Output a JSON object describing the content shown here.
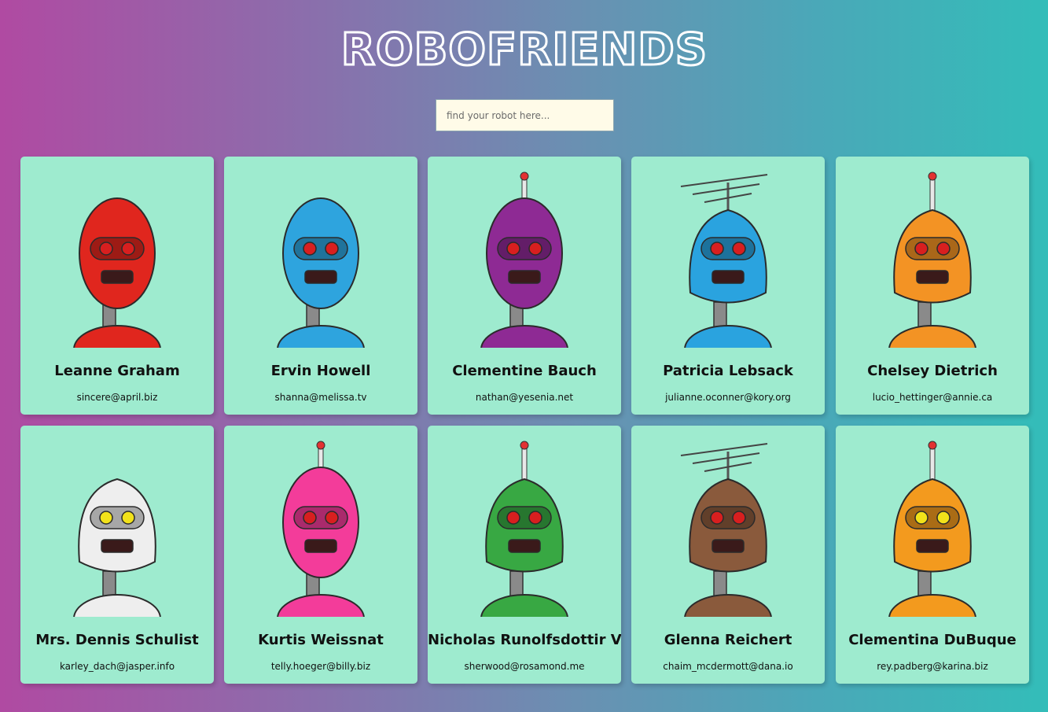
{
  "app": {
    "title": "ROBOFRIENDS"
  },
  "search": {
    "placeholder": "find your robot here..."
  },
  "robots": [
    {
      "name": "Leanne Graham",
      "email": "sincere@april.biz",
      "color": "#e0261e"
    },
    {
      "name": "Ervin Howell",
      "email": "shanna@melissa.tv",
      "color": "#2ea4de"
    },
    {
      "name": "Clementine Bauch",
      "email": "nathan@yesenia.net",
      "color": "#8e2a94"
    },
    {
      "name": "Patricia Lebsack",
      "email": "julianne.oconner@kory.org",
      "color": "#2aa3df"
    },
    {
      "name": "Chelsey Dietrich",
      "email": "lucio_hettinger@annie.ca",
      "color": "#f39324"
    },
    {
      "name": "Mrs. Dennis Schulist",
      "email": "karley_dach@jasper.info",
      "color": "#eeeeee"
    },
    {
      "name": "Kurtis Weissnat",
      "email": "telly.hoeger@billy.biz",
      "color": "#f33c9a"
    },
    {
      "name": "Nicholas Runolfsdottir V",
      "email": "sherwood@rosamond.me",
      "color": "#38a843"
    },
    {
      "name": "Glenna Reichert",
      "email": "chaim_mcdermott@dana.io",
      "color": "#8a5a3c"
    },
    {
      "name": "Clementina DuBuque",
      "email": "rey.padberg@karina.biz",
      "color": "#f39a1e"
    }
  ]
}
